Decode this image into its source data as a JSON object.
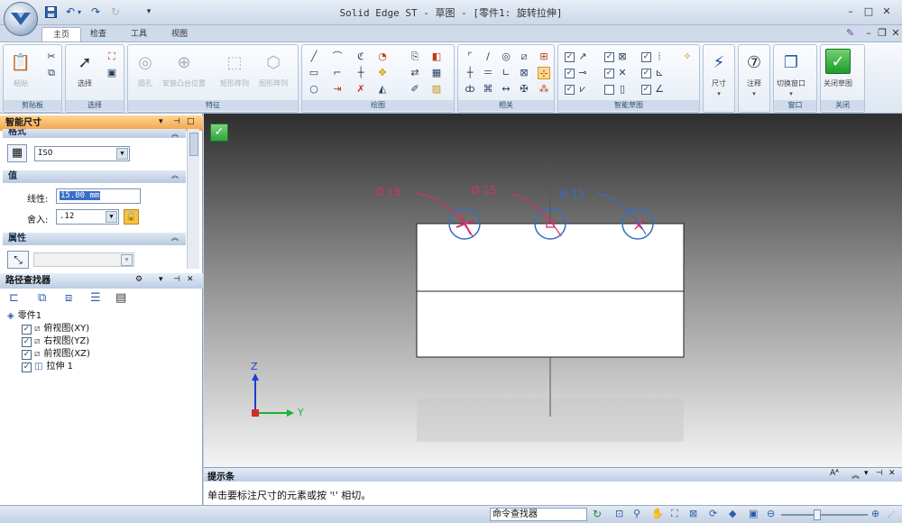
{
  "window": {
    "title": "Solid Edge ST - 草图 - [零件1: 旋转拉伸]"
  },
  "qat": {
    "more": "▾"
  },
  "ribbon": {
    "tabs": [
      "主页",
      "检查",
      "工具",
      "视图"
    ],
    "groups": {
      "clipboard": {
        "label": "剪贴板",
        "paste": "粘贴"
      },
      "select": {
        "label": "选择",
        "select": "选择"
      },
      "features": {
        "label": "特征",
        "hole": "圆孔",
        "place": "安装凸台位置",
        "rect": "矩形阵列",
        "pattern": "图形阵列"
      },
      "draw": {
        "label": "绘图"
      },
      "relate": {
        "label": "相关"
      },
      "smart": {
        "label": "智能草图"
      },
      "dimension": {
        "label": "尺寸"
      },
      "annotate": {
        "label": "注释"
      },
      "window": {
        "label": "窗口",
        "switch": "切换窗口"
      },
      "close": {
        "label": "关闭",
        "close_sketch": "关闭草图"
      }
    }
  },
  "smart_dim": {
    "title": "智能尺寸",
    "format_header": "格式",
    "standard": "ISO",
    "value_header": "值",
    "linear_label": "线性:",
    "linear_value": "15.00 mm",
    "round_label": "舍入:",
    "round_value": ".12",
    "props_header": "属性"
  },
  "pathfinder": {
    "title": "路径查找器",
    "root": "零件1",
    "items": [
      "俯视图(XY)",
      "右视图(YZ)",
      "前视图(XZ)",
      "拉伸 1"
    ]
  },
  "viewport": {
    "dims": [
      "Ø 15",
      "Ø 15",
      "Ø 15"
    ],
    "axes": {
      "z": "Z",
      "y": "Y"
    },
    "colors": {
      "dim_red": "#d0336a",
      "dim_blue": "#3a6cc4"
    }
  },
  "tipbar": {
    "title": "提示条",
    "text": "单击要标注尺寸的元素或按 'ᵗ' 相切。"
  },
  "statusbar": {
    "cmd_finder": "命令查找器"
  }
}
